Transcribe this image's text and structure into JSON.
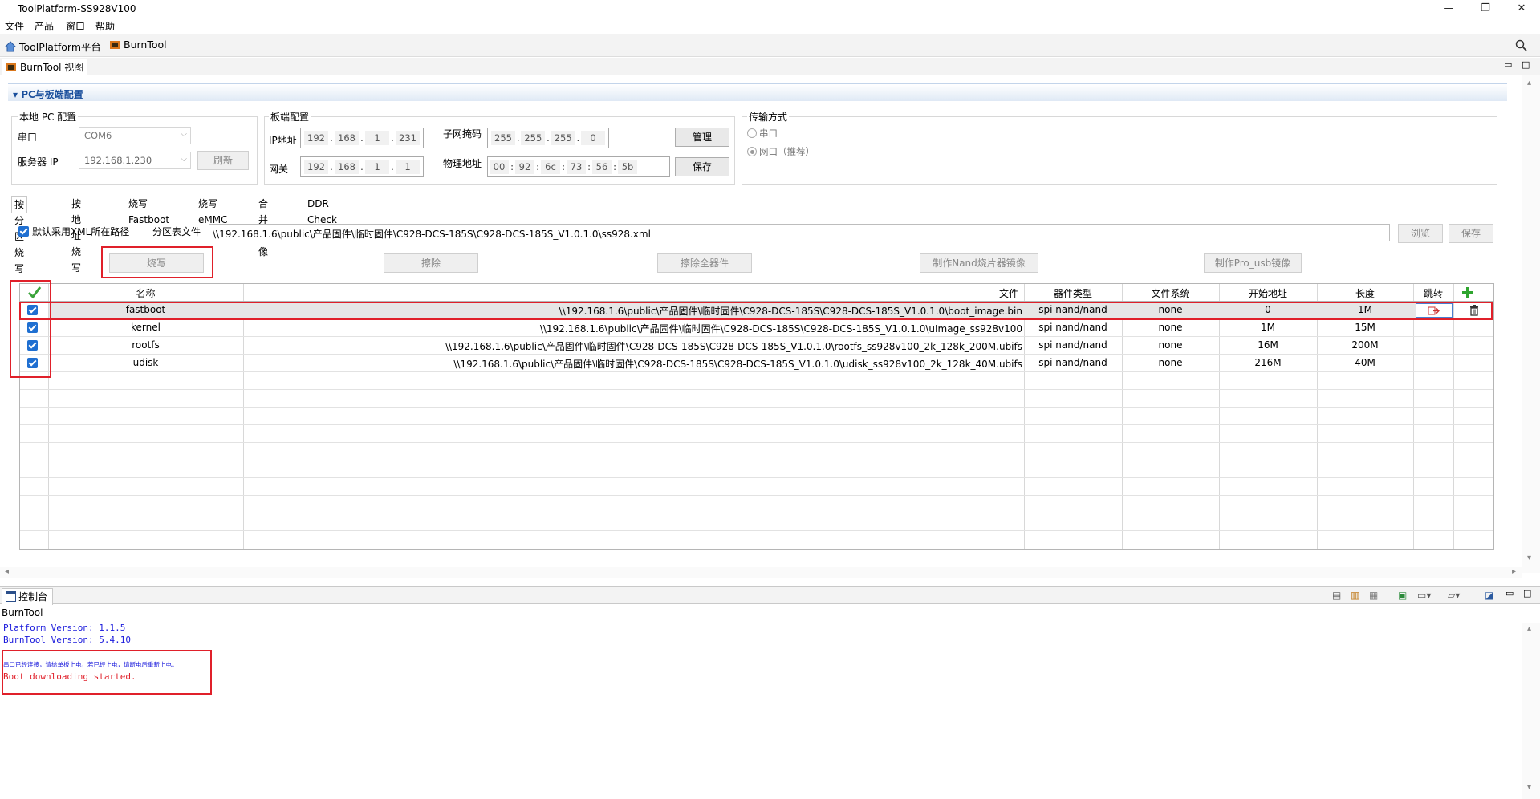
{
  "window": {
    "title": "ToolPlatform-SS928V100",
    "minimize": "—",
    "maximize": "❐",
    "close": "✕"
  },
  "menu": [
    "文件",
    "产品",
    "窗口",
    "帮助"
  ],
  "toolbar": {
    "platform_label": "ToolPlatform平台",
    "burntool_label": "BurnTool"
  },
  "view_tab": {
    "label": "BurnTool 视图"
  },
  "section": {
    "title": "PC与板端配置"
  },
  "local_pc": {
    "group_title": "本地 PC 配置",
    "serial_label": "串口",
    "serial_value": "COM6",
    "server_ip_label": "服务器 IP",
    "server_ip_value": "192.168.1.230",
    "refresh_button": "刷新"
  },
  "board": {
    "group_title": "板端配置",
    "ip_label": "IP地址",
    "ip": [
      "192",
      "168",
      "1",
      "231"
    ],
    "gateway_label": "网关",
    "gateway": [
      "192",
      "168",
      "1",
      "1"
    ],
    "mask_label": "子网掩码",
    "mask": [
      "255",
      "255",
      "255",
      "0"
    ],
    "mac_label": "物理地址",
    "mac": [
      "00",
      "92",
      "6c",
      "73",
      "56",
      "5b"
    ],
    "manage_button": "管理",
    "save_button": "保存"
  },
  "transfer": {
    "group_title": "传输方式",
    "option_serial": "串口",
    "option_network": "网口（推荐）",
    "selected": "network"
  },
  "tabs": [
    "按分区烧写",
    "按地址烧写",
    "烧写Fastboot",
    "烧写eMMC",
    "合并镜像",
    "DDR Check"
  ],
  "partition": {
    "use_xml_path_label": "默认采用XML所在路径",
    "table_file_label": "分区表文件",
    "table_file_path": "\\\\192.168.1.6\\public\\产品固件\\临时固件\\C928-DCS-185S\\C928-DCS-185S_V1.0.1.0\\ss928.xml",
    "browse_button": "浏览",
    "save_button": "保存",
    "burn_button": "烧写",
    "erase_button": "擦除",
    "erase_all_button": "擦除全器件",
    "nand_image_button": "制作Nand烧片器镜像",
    "pro_usb_button": "制作Pro_usb镜像"
  },
  "grid": {
    "headers": {
      "name": "名称",
      "file": "文件",
      "device_type": "器件类型",
      "fs": "文件系统",
      "start": "开始地址",
      "length": "长度",
      "jump": "跳转"
    },
    "rows": [
      {
        "name": "fastboot",
        "file": "\\\\192.168.1.6\\public\\产品固件\\临时固件\\C928-DCS-185S\\C928-DCS-185S_V1.0.1.0\\boot_image.bin",
        "device_type": "spi nand/nand",
        "fs": "none",
        "start": "0",
        "length": "1M"
      },
      {
        "name": "kernel",
        "file": "\\\\192.168.1.6\\public\\产品固件\\临时固件\\C928-DCS-185S\\C928-DCS-185S_V1.0.1.0\\uImage_ss928v100",
        "device_type": "spi nand/nand",
        "fs": "none",
        "start": "1M",
        "length": "15M"
      },
      {
        "name": "rootfs",
        "file": "\\\\192.168.1.6\\public\\产品固件\\临时固件\\C928-DCS-185S\\C928-DCS-185S_V1.0.1.0\\rootfs_ss928v100_2k_128k_200M.ubifs",
        "device_type": "spi nand/nand",
        "fs": "none",
        "start": "16M",
        "length": "200M"
      },
      {
        "name": "udisk",
        "file": "\\\\192.168.1.6\\public\\产品固件\\临时固件\\C928-DCS-185S\\C928-DCS-185S_V1.0.1.0\\udisk_ss928v100_2k_128k_40M.ubifs",
        "device_type": "spi nand/nand",
        "fs": "none",
        "start": "216M",
        "length": "40M"
      }
    ]
  },
  "console": {
    "tab_label": "控制台",
    "name": "BurnTool",
    "lines": [
      {
        "text": "Platform Version: 1.1.5",
        "color": "#1a1adc"
      },
      {
        "text": "BurnTool Version: 5.4.10",
        "color": "#1a1adc"
      },
      {
        "text": "串口已经连接，请给单板上电，若已经上电，请断电后重新上电。",
        "color": "#1a1adc"
      },
      {
        "text": "Boot downloading started.",
        "color": "#e0202a"
      }
    ]
  }
}
